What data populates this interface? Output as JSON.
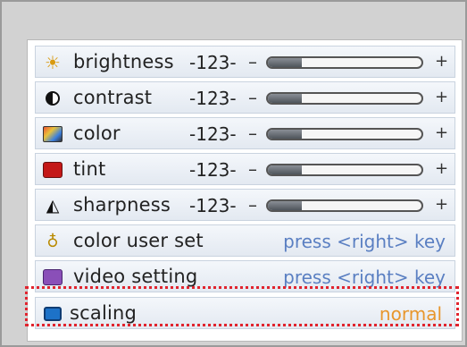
{
  "menu": {
    "rows": [
      {
        "label": "brightness",
        "value": "-123-",
        "minus": "–",
        "plus": "+",
        "level": 0.22,
        "icon": "sun-icon"
      },
      {
        "label": "contrast",
        "value": "-123-",
        "minus": "–",
        "plus": "+",
        "level": 0.22,
        "icon": "contrast-icon"
      },
      {
        "label": "color",
        "value": "-123-",
        "minus": "–",
        "plus": "+",
        "level": 0.22,
        "icon": "color-icon"
      },
      {
        "label": "tint",
        "value": "-123-",
        "minus": "–",
        "plus": "+",
        "level": 0.22,
        "icon": "tint-icon"
      },
      {
        "label": "sharpness",
        "value": "-123-",
        "minus": "–",
        "plus": "+",
        "level": 0.22,
        "icon": "sharpness-icon"
      },
      {
        "label": "color user set",
        "action": "press <right> key",
        "icon": "color-user-set-icon"
      },
      {
        "label": "video setting",
        "action": "press <right> key",
        "icon": "video-setting-icon"
      },
      {
        "label": "scaling",
        "status": "normal",
        "icon": "scaling-icon"
      }
    ]
  },
  "colors": {
    "action_text": "#5a7fc2",
    "status_text": "#e8962c",
    "focus_outline": "#e0242e"
  }
}
